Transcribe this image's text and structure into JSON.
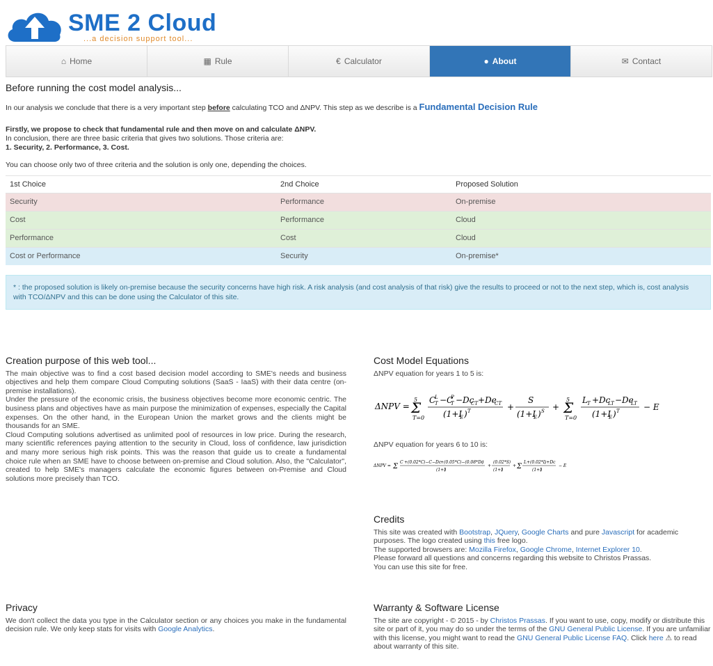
{
  "logo": {
    "brand": "SME 2 Cloud",
    "tagline": "...a decision support tool..."
  },
  "nav": [
    {
      "icon": "home-icon",
      "glyph": "⌂",
      "label": "Home"
    },
    {
      "icon": "table-icon",
      "glyph": "▦",
      "label": "Rule"
    },
    {
      "icon": "euro-icon",
      "glyph": "€",
      "label": "Calculator"
    },
    {
      "icon": "info-icon",
      "glyph": "●",
      "label": "About"
    },
    {
      "icon": "envelope-icon",
      "glyph": "✉",
      "label": "Contact"
    }
  ],
  "intro": {
    "heading": "Before running the cost model analysis...",
    "line1_a": "In our analysis we conclude that there is a very important step ",
    "line1_b": "before",
    "line1_c": " calculating TCO and ΔNPV. This step as we describe is a ",
    "line1_link": "Fundamental Decision Rule",
    "line2": "Firstly, we propose to check that fundamental rule and then move on and calculate ΔNPV.",
    "line3": "In conclusion, there are three basic criteria that gives two solutions. Those criteria are:",
    "line4": "1. Security, 2. Performance, 3. Cost.",
    "line5": "You can choose only two of three criteria and the solution is only one, depending the choices."
  },
  "table": {
    "headers": [
      "1st Choice",
      "2nd Choice",
      "Proposed Solution"
    ],
    "rows": [
      [
        "Security",
        "Performance",
        "On-premise"
      ],
      [
        "Cost",
        "Performance",
        "Cloud"
      ],
      [
        "Performance",
        "Cost",
        "Cloud"
      ],
      [
        "Cost or Performance",
        "Security",
        "On-premise*"
      ]
    ]
  },
  "alert": "* : the proposed solution is likely on-premise because the security concerns have high risk. A risk analysis (and cost analysis of that risk) give the results to proceed or not to the next step, which is, cost analysis with TCO/ΔNPV and this can be done using the Calculator of this site.",
  "purpose": {
    "heading": "Creation purpose of this web tool...",
    "p1": "The main objective was to find a cost based decision model according to SME's needs and business objectives and help them compare Cloud Computing solutions (SaaS - IaaS) with their data centre (on-premise installations).",
    "p2": "Under the pressure of the economic crisis, the business objectives become more economic centric. The business plans and objectives have as main purpose the minimization of expenses, especially the Capital expenses. On the other hand, in the European Union the market grows and the clients might be thousands for an SME.",
    "p3": "Cloud Computing solutions advertised as unlimited pool of resources in low price. During the research, many scientific references paying attention to the security in Cloud, loss of confidence, law jurisdiction and many more serious high risk points. This was the reason that guide us to create a fundamental choice rule when an SME have to choose between on-premise and Cloud solution. Also, the \"Calculator\", created to help SME's managers calculate the economic figures between on-Premise and Cloud solutions more precisely than TCO."
  },
  "equations": {
    "heading": "Cost Model Equations",
    "label1": "ΔNPV equation for years 1 to 5 is:",
    "label2": "ΔNPV equation for years 6 to 10 is:"
  },
  "credits": {
    "heading": "Credits",
    "t1": "This site was created with ",
    "l_bootstrap": "Bootstrap",
    "l_jquery": "JQuery",
    "l_charts": "Google Charts",
    "t_and": " and pure ",
    "l_js": "Javascript",
    "t2": " for academic purposes. The logo created using ",
    "l_this": "this",
    "t3": " free logo.",
    "t4": "The supported browsers are: ",
    "l_ff": "Mozilla Firefox",
    "l_chrome": "Google Chrome",
    "l_ie": "Internet Explorer 10",
    "t5": "Please forward all questions and concerns regarding this website to Christos Prassas.",
    "t6": "You can use this site for free."
  },
  "privacy": {
    "heading": "Privacy",
    "text": "We don't collect the data you type in the Calculator section or any choices you make in the fundamental decision rule. We only keep stats for visits with ",
    "link": "Google Analytics"
  },
  "license": {
    "heading": "Warranty & Software License",
    "t1": "The site are copyright - © 2015 - by ",
    "l_author": "Christos Prassas",
    "t2": ". If you want to use, copy, modify or distribute this site or part of it, you may do so under the terms of the ",
    "l_gpl": "GNU General Public License",
    "t3": ". If you are unfamiliar with this license, you might want to read the ",
    "l_faq": "GNU General Public License FAQ",
    "t4": ". Click ",
    "l_here": "here",
    "t5": " to read about warranty of this site."
  }
}
